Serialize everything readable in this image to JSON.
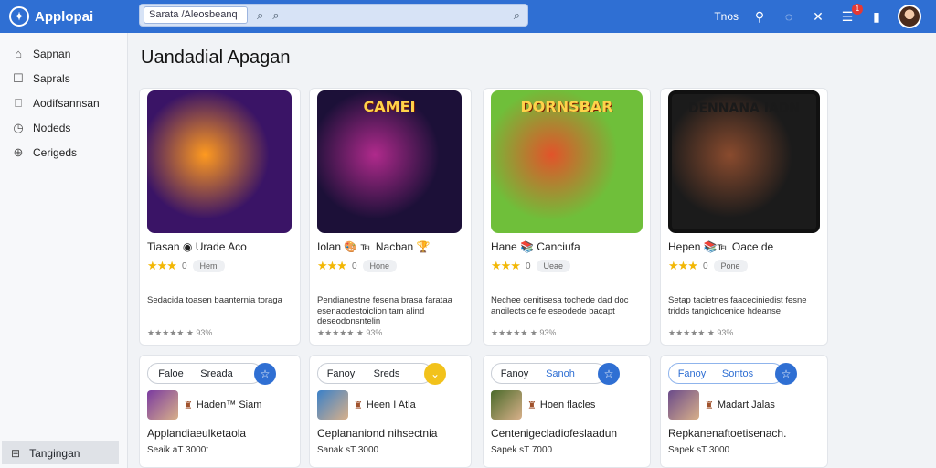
{
  "app": {
    "name": "Applopai"
  },
  "search": {
    "value": "Sarata /Aleosbeanq",
    "placeholder": "Search"
  },
  "topbar": {
    "label": "Tnos",
    "notifications": "1"
  },
  "sidebar": {
    "items": [
      {
        "label": "Sapnan",
        "icon": "home-icon"
      },
      {
        "label": "Saprals",
        "icon": "square-icon"
      },
      {
        "label": "Aodifsannsan",
        "icon": "bookmark-icon"
      },
      {
        "label": "Nodeds",
        "icon": "clock-icon"
      },
      {
        "label": "Cerigeds",
        "icon": "plus-circle-icon"
      }
    ],
    "bottom": {
      "label": "Tangingan"
    }
  },
  "main": {
    "title": "Uandadial Apagan",
    "games": [
      {
        "art_title": "",
        "title": "Tiasan ◉ Urade Aco",
        "rating": 3,
        "count": "0",
        "chip": "Hem",
        "desc": "Sedacida toasen baanternia toraga",
        "meta": "★★★★★ ★ 93%",
        "colors": [
          "#3a1466",
          "#ff9a1f",
          "#2b6bd9"
        ]
      },
      {
        "art_title": "CAMEI",
        "title": "Iolan 🎨 ℡ Nacban 🏆",
        "rating": 3,
        "count": "0",
        "chip": "Hone",
        "desc": "Pendianestne fesena brasa farataa esenaodestoiclion tam alind deseodonsntelin",
        "meta": "★★★★★ ★ 93%",
        "colors": [
          "#1c1038",
          "#b02a8c",
          "#3a9cd6"
        ]
      },
      {
        "art_title": "DORNSBAR",
        "title": "Hane 📚 Canciufa",
        "rating": 3,
        "count": "0",
        "chip": "Ueae",
        "desc": "Nechee cenitisesa tochede dad doc anoilectsice fe eseodede bacapt",
        "meta": "★★★★★ ★ 93%",
        "colors": [
          "#6fbf3a",
          "#e2532a",
          "#2b8ed6"
        ]
      },
      {
        "art_title": "DENNANA IADN",
        "title": "Hepen 📚℡ Oace de",
        "rating": 3,
        "count": "0",
        "chip": "Pone",
        "desc": "Setap tacietnes faaceciniedist fesne tridds tangichcenice hdeanse",
        "meta": "★★★★★ ★ 93%",
        "colors": [
          "#1b1b1b",
          "#8a4b2e",
          "#c9b89a"
        ]
      }
    ],
    "bottom_cards": [
      {
        "seg_a": "Faloe",
        "seg_b": "Sreada",
        "btn": "☆",
        "btn_color": "#2f6fd3",
        "mini": "Haden™ Siam",
        "desc": "Applandiaeulketaola",
        "meta": "Seaik  aT 3000t",
        "color": "#7a3aa0"
      },
      {
        "seg_a": "Fanoy",
        "seg_b": "Sreds",
        "btn": "⌄",
        "btn_color": "#f2c21b",
        "mini": "Heen I Atla",
        "desc": "Ceplananiond nihsectnia",
        "meta": "Sanak  sT 3000",
        "color": "#3a80c8"
      },
      {
        "seg_a": "Fanoy",
        "seg_b": "Sanoh",
        "btn": "☆",
        "btn_color": "#2f6fd3",
        "mini": "Hoen flacles",
        "desc": "Centenigecladiofeslaadun",
        "meta": "Sapek  sT 7000",
        "color": "#4a6a2a"
      },
      {
        "seg_a": "Fanoy",
        "seg_b": "Sontos",
        "btn": "☆",
        "btn_color": "#2f6fd3",
        "mini": "Madart Jalas",
        "desc": "Repkanenaftoetisenach.",
        "meta": "Sapek  sT 3000",
        "color": "#6a4a8a"
      }
    ]
  }
}
